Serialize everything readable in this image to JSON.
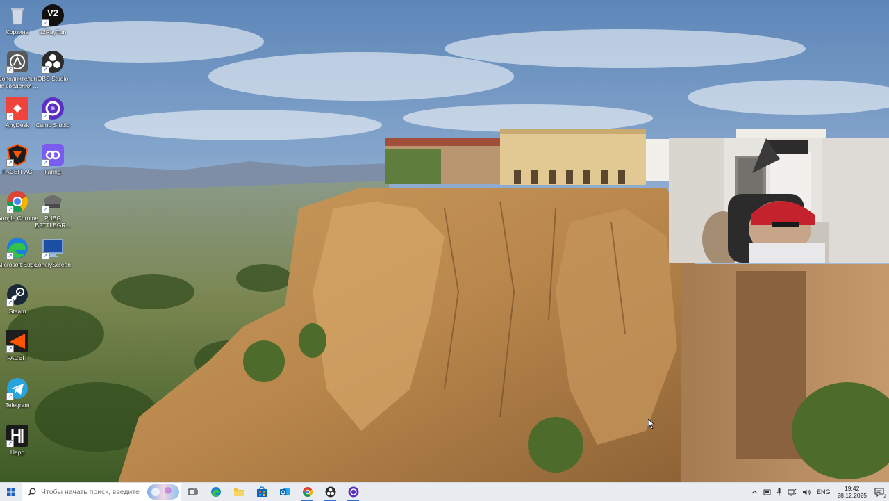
{
  "desktop_icons": [
    {
      "label": "Корзина",
      "icon": "recycle-bin-icon"
    },
    {
      "label": "v2RayTun",
      "icon": "v2raytun-icon",
      "badge": "V2"
    },
    {
      "label": "Дополнительные сведения ...",
      "icon": "info-icon"
    },
    {
      "label": "OBS Studio",
      "icon": "obs-icon"
    },
    {
      "label": "AnyDesk",
      "icon": "anydesk-icon"
    },
    {
      "label": "Camo Studio",
      "icon": "camo-icon"
    },
    {
      "label": "FACEIT AC",
      "icon": "faceit-ac-icon"
    },
    {
      "label": "karing",
      "icon": "karing-icon"
    },
    {
      "label": "Google Chrome",
      "icon": "chrome-icon"
    },
    {
      "label": "PUBG BATTLEGR...",
      "icon": "pubg-icon"
    },
    {
      "label": "Microsoft Edge",
      "icon": "edge-icon"
    },
    {
      "label": "LonelyScreen",
      "icon": "lonelyscreen-icon"
    },
    {
      "label": "Steam",
      "icon": "steam-icon"
    },
    {
      "label": "FACEIT",
      "icon": "faceit-icon"
    },
    {
      "label": "Telegram",
      "icon": "telegram-icon"
    },
    {
      "label": "Happ",
      "icon": "happ-icon"
    }
  ],
  "taskbar": {
    "search_placeholder": "Чтобы начать поиск, введите",
    "apps": [
      "task-view",
      "edge",
      "file-explorer",
      "microsoft-store",
      "outlook",
      "chrome",
      "obs",
      "camo"
    ],
    "language": "ENG",
    "time": "19:42",
    "date": "28.12.2025",
    "notification_count": "2"
  },
  "colors": {
    "taskbar_bg": "#e9edf2",
    "accent": "#2e6fd6"
  }
}
